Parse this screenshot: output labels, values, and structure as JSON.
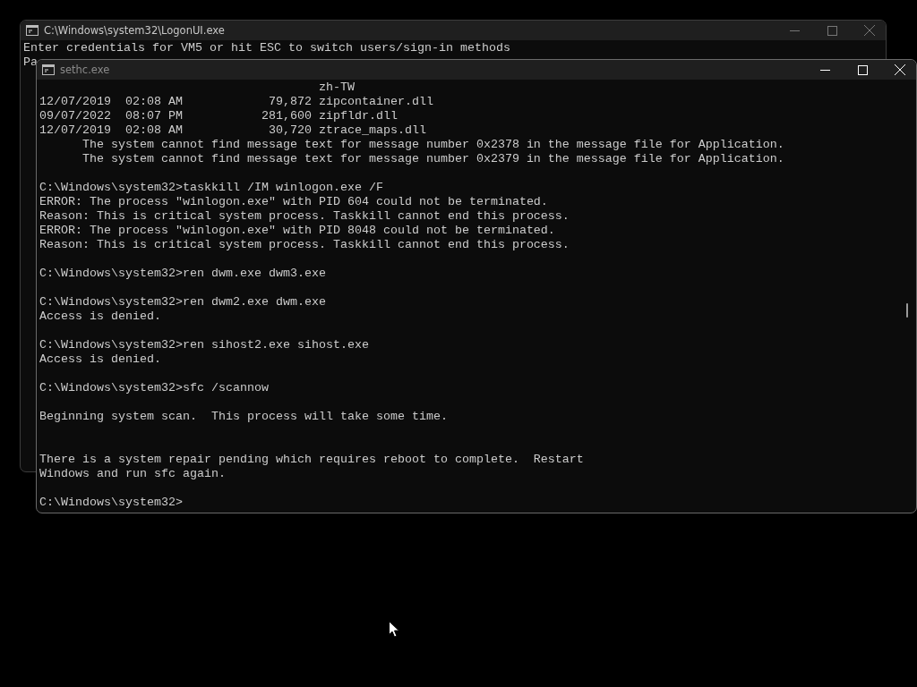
{
  "windows": [
    {
      "title": "C:\\Windows\\system32\\LogonUI.exe",
      "active": false,
      "lines": [
        {
          "kind": "text",
          "text": "Enter credentials for VM5 or hit ESC to switch users/sign-in methods"
        },
        {
          "kind": "text",
          "text": "Pa"
        }
      ]
    },
    {
      "title": "sethc.exe",
      "active": true,
      "lines": [
        {
          "kind": "text",
          "text": "                                       zh-TW"
        },
        {
          "kind": "text",
          "text": "12/07/2019  02:08 AM            79,872 zipcontainer.dll"
        },
        {
          "kind": "text",
          "text": "09/07/2022  08:07 PM           281,600 zipfldr.dll"
        },
        {
          "kind": "text",
          "text": "12/07/2019  02:08 AM            30,720 ztrace_maps.dll"
        },
        {
          "kind": "text",
          "text": "      The system cannot find message text for message number 0x2378 in the message file for Application."
        },
        {
          "kind": "text",
          "text": "      The system cannot find message text for message number 0x2379 in the message file for Application."
        },
        {
          "kind": "blank"
        },
        {
          "kind": "text",
          "text": "C:\\Windows\\system32>taskkill /IM winlogon.exe /F"
        },
        {
          "kind": "text",
          "text": "ERROR: The process \"winlogon.exe\" with PID 604 could not be terminated."
        },
        {
          "kind": "text",
          "text": "Reason: This is critical system process. Taskkill cannot end this process."
        },
        {
          "kind": "text",
          "text": "ERROR: The process \"winlogon.exe\" with PID 8048 could not be terminated."
        },
        {
          "kind": "text",
          "text": "Reason: This is critical system process. Taskkill cannot end this process."
        },
        {
          "kind": "blank"
        },
        {
          "kind": "text",
          "text": "C:\\Windows\\system32>ren dwm.exe dwm3.exe"
        },
        {
          "kind": "blank"
        },
        {
          "kind": "text",
          "text": "C:\\Windows\\system32>ren dwm2.exe dwm.exe"
        },
        {
          "kind": "text",
          "text": "Access is denied."
        },
        {
          "kind": "blank"
        },
        {
          "kind": "text",
          "text": "C:\\Windows\\system32>ren sihost2.exe sihost.exe"
        },
        {
          "kind": "text",
          "text": "Access is denied."
        },
        {
          "kind": "blank"
        },
        {
          "kind": "text",
          "text": "C:\\Windows\\system32>sfc /scannow"
        },
        {
          "kind": "blank"
        },
        {
          "kind": "text",
          "text": "Beginning system scan.  This process will take some time."
        },
        {
          "kind": "blank"
        },
        {
          "kind": "blank"
        },
        {
          "kind": "text",
          "text": "There is a system repair pending which requires reboot to complete.  Restart"
        },
        {
          "kind": "text",
          "text": "Windows and run sfc again."
        },
        {
          "kind": "blank"
        },
        {
          "kind": "text",
          "text": "C:\\Windows\\system32>"
        }
      ]
    }
  ]
}
